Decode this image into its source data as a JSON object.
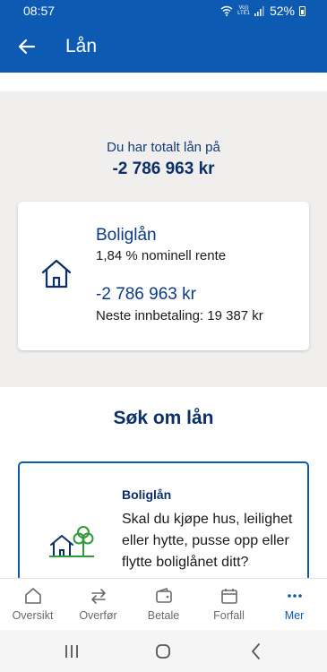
{
  "status_bar": {
    "time": "08:57",
    "net_top": "Vo))",
    "net_bottom": "LTE1",
    "battery": "52%"
  },
  "app_bar": {
    "title": "Lån"
  },
  "summary": {
    "label": "Du har totalt lån på",
    "total": "-2 786 963 kr"
  },
  "loan": {
    "name": "Boliglån",
    "rate": "1,84 % nominell rente",
    "amount": "-2 786 963 kr",
    "next_payment": "Neste innbetaling: 19 387 kr"
  },
  "apply": {
    "title": "Søk om lån",
    "card_title": "Boliglån",
    "card_desc": "Skal du kjøpe hus, leilighet eller hytte, pusse opp eller flytte boliglånet ditt?"
  },
  "bottom_nav": {
    "items": [
      {
        "label": "Oversikt",
        "icon": "home-icon"
      },
      {
        "label": "Overfør",
        "icon": "transfer-icon"
      },
      {
        "label": "Betale",
        "icon": "wallet-icon"
      },
      {
        "label": "Forfall",
        "icon": "calendar-icon"
      },
      {
        "label": "Mer",
        "icon": "more-icon"
      }
    ],
    "active_index": 4
  },
  "colors": {
    "primary": "#0c5ab2",
    "dark_blue": "#0b2f6a",
    "summary_bg": "#f0efed",
    "green": "#2f9a3a"
  }
}
